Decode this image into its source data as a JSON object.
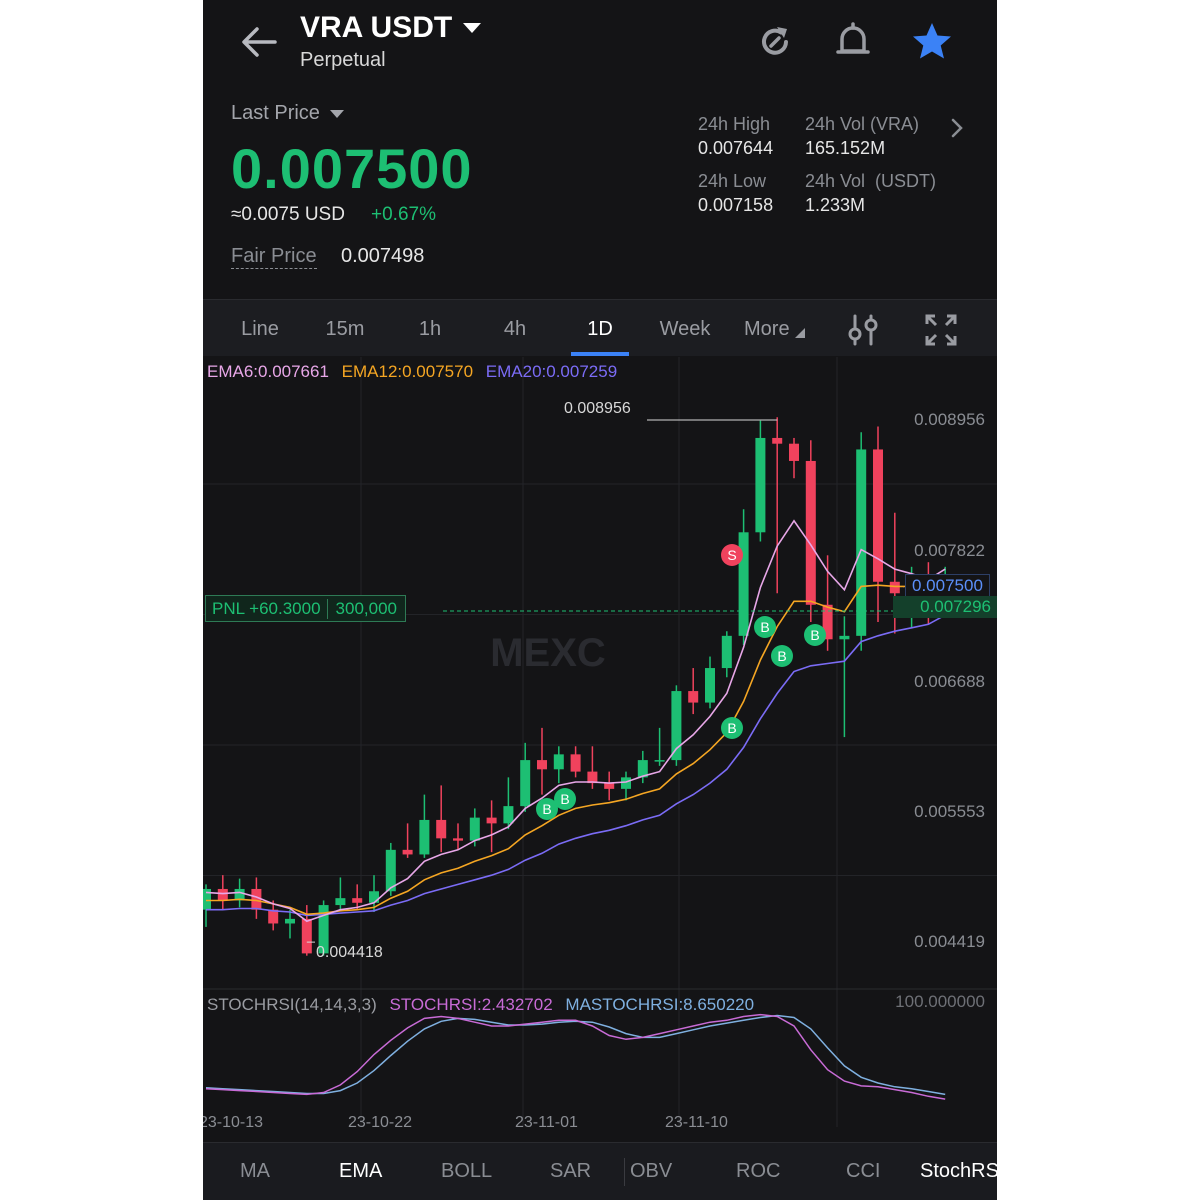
{
  "header": {
    "pair": "VRA USDT",
    "contract_type": "Perpetual",
    "icons": {
      "back": "back-arrow-icon",
      "dropdown": "caret-down-icon",
      "refresh": "refresh-icon",
      "alert": "bell-icon",
      "favorite": "star-icon"
    },
    "colors": {
      "favorite": "#3b82f6"
    }
  },
  "price": {
    "label": "Last Price",
    "value": "0.007500",
    "usd": "≈0.0075 USD",
    "change": "+0.67%",
    "fair_label": "Fair Price",
    "fair_value": "0.007498"
  },
  "stats": {
    "high_label": "24h High",
    "high": "0.007644",
    "low_label": "24h Low",
    "low": "0.007158",
    "vol_vra_label": "24h Vol (VRA)",
    "vol_vra": "165.152M",
    "vol_usdt_label": "24h Vol  (USDT)",
    "vol_usdt": "1.233M"
  },
  "timeframes": [
    "Line",
    "15m",
    "1h",
    "4h",
    "1D",
    "Week",
    "More"
  ],
  "active_timeframe": "1D",
  "ema_legend": {
    "ema6": "EMA6:0.007661",
    "ema12": "EMA12:0.007570",
    "ema20": "EMA20:0.007259"
  },
  "chart_labels": {
    "max": "0.008956",
    "min": "0.004418",
    "current": "0.007500",
    "pnl_price": "0.007296",
    "pnl_label": "PNL +60.3000",
    "pnl_size": "300,000",
    "watermark": "MEXC"
  },
  "y_axis": [
    "0.008956",
    "0.007822",
    "0.006688",
    "0.005553",
    "0.004419"
  ],
  "stoch_legend": {
    "params": "STOCHRSI(14,14,3,3)",
    "stoch": "STOCHRSI:2.432702",
    "ma": "MASTOCHRSI:8.650220",
    "top": "100.000000"
  },
  "x_axis": [
    "23-10-13",
    "23-10-22",
    "23-11-01",
    "23-11-10"
  ],
  "indicator_tabs": [
    "MA",
    "EMA",
    "BOLL",
    "SAR",
    "OBV",
    "ROC",
    "CCI",
    "StochRSI"
  ],
  "active_indicator": "EMA",
  "colors": {
    "up": "#1dbf73",
    "down": "#f0425d",
    "ema6": "#e8a7e8",
    "ema12": "#f5a623",
    "ema20": "#7b6cf6",
    "stochrsi": "#c86bd6",
    "mastochrsi": "#7fb0e0"
  },
  "chart_data": {
    "type": "candlestick",
    "interval": "1D",
    "candles": [
      {
        "o": 0.0047,
        "h": 0.00492,
        "l": 0.00455,
        "c": 0.00488
      },
      {
        "o": 0.00488,
        "h": 0.005,
        "l": 0.0047,
        "c": 0.00478
      },
      {
        "o": 0.00478,
        "h": 0.00497,
        "l": 0.00472,
        "c": 0.00488
      },
      {
        "o": 0.00488,
        "h": 0.00498,
        "l": 0.00462,
        "c": 0.0047
      },
      {
        "o": 0.0047,
        "h": 0.00478,
        "l": 0.00452,
        "c": 0.00458
      },
      {
        "o": 0.00458,
        "h": 0.0047,
        "l": 0.00445,
        "c": 0.00462
      },
      {
        "o": 0.00462,
        "h": 0.00474,
        "l": 0.0043,
        "c": 0.00432
      },
      {
        "o": 0.00432,
        "h": 0.00478,
        "l": 0.0043,
        "c": 0.00474
      },
      {
        "o": 0.00474,
        "h": 0.00498,
        "l": 0.0047,
        "c": 0.0048
      },
      {
        "o": 0.0048,
        "h": 0.00492,
        "l": 0.0047,
        "c": 0.00476
      },
      {
        "o": 0.00476,
        "h": 0.005,
        "l": 0.00468,
        "c": 0.00486
      },
      {
        "o": 0.00486,
        "h": 0.00528,
        "l": 0.00482,
        "c": 0.00522
      },
      {
        "o": 0.00522,
        "h": 0.00545,
        "l": 0.00515,
        "c": 0.00518
      },
      {
        "o": 0.00518,
        "h": 0.0057,
        "l": 0.00515,
        "c": 0.00548
      },
      {
        "o": 0.00548,
        "h": 0.00578,
        "l": 0.0052,
        "c": 0.00532
      },
      {
        "o": 0.00532,
        "h": 0.00545,
        "l": 0.00522,
        "c": 0.0053
      },
      {
        "o": 0.0053,
        "h": 0.00558,
        "l": 0.00525,
        "c": 0.0055
      },
      {
        "o": 0.0055,
        "h": 0.00565,
        "l": 0.0052,
        "c": 0.00545
      },
      {
        "o": 0.00545,
        "h": 0.00585,
        "l": 0.0054,
        "c": 0.0056
      },
      {
        "o": 0.0056,
        "h": 0.00615,
        "l": 0.00555,
        "c": 0.006
      },
      {
        "o": 0.006,
        "h": 0.00628,
        "l": 0.0057,
        "c": 0.00592
      },
      {
        "o": 0.00592,
        "h": 0.00612,
        "l": 0.0058,
        "c": 0.00605
      },
      {
        "o": 0.00605,
        "h": 0.00612,
        "l": 0.00585,
        "c": 0.0059
      },
      {
        "o": 0.0059,
        "h": 0.00612,
        "l": 0.00575,
        "c": 0.0058
      },
      {
        "o": 0.0058,
        "h": 0.0059,
        "l": 0.00565,
        "c": 0.00575
      },
      {
        "o": 0.00575,
        "h": 0.0059,
        "l": 0.00565,
        "c": 0.00585
      },
      {
        "o": 0.00585,
        "h": 0.00608,
        "l": 0.0058,
        "c": 0.006
      },
      {
        "o": 0.006,
        "h": 0.00628,
        "l": 0.00595,
        "c": 0.006
      },
      {
        "o": 0.006,
        "h": 0.00665,
        "l": 0.00595,
        "c": 0.0066
      },
      {
        "o": 0.0066,
        "h": 0.0068,
        "l": 0.0064,
        "c": 0.0065
      },
      {
        "o": 0.0065,
        "h": 0.0069,
        "l": 0.00645,
        "c": 0.0068
      },
      {
        "o": 0.0068,
        "h": 0.00712,
        "l": 0.00672,
        "c": 0.00708
      },
      {
        "o": 0.00708,
        "h": 0.00818,
        "l": 0.007,
        "c": 0.00798
      },
      {
        "o": 0.00798,
        "h": 0.00895,
        "l": 0.0079,
        "c": 0.0088
      },
      {
        "o": 0.0088,
        "h": 0.00898,
        "l": 0.00745,
        "c": 0.00875
      },
      {
        "o": 0.00875,
        "h": 0.0088,
        "l": 0.00845,
        "c": 0.0086
      },
      {
        "o": 0.0086,
        "h": 0.00878,
        "l": 0.0072,
        "c": 0.00735
      },
      {
        "o": 0.00735,
        "h": 0.00778,
        "l": 0.00695,
        "c": 0.00705
      },
      {
        "o": 0.00705,
        "h": 0.00725,
        "l": 0.0062,
        "c": 0.00708
      },
      {
        "o": 0.00708,
        "h": 0.00885,
        "l": 0.00695,
        "c": 0.0087
      },
      {
        "o": 0.0087,
        "h": 0.0089,
        "l": 0.0072,
        "c": 0.00755
      },
      {
        "o": 0.00755,
        "h": 0.00815,
        "l": 0.0071,
        "c": 0.00745
      },
      {
        "o": 0.00745,
        "h": 0.00768,
        "l": 0.00715,
        "c": 0.00752
      },
      {
        "o": 0.00752,
        "h": 0.00772,
        "l": 0.00718,
        "c": 0.00745
      },
      {
        "o": 0.00745,
        "h": 0.00768,
        "l": 0.0073,
        "c": 0.0075
      }
    ],
    "ema6": [
      0.00485,
      0.00484,
      0.00485,
      0.00481,
      0.00475,
      0.00471,
      0.0046,
      0.00465,
      0.0047,
      0.00472,
      0.00476,
      0.00489,
      0.00497,
      0.00512,
      0.00518,
      0.00522,
      0.0053,
      0.00535,
      0.00542,
      0.00558,
      0.00567,
      0.00578,
      0.00581,
      0.00581,
      0.0058,
      0.00581,
      0.00586,
      0.0059,
      0.0061,
      0.00622,
      0.00638,
      0.00658,
      0.00698,
      0.0075,
      0.00786,
      0.00808,
      0.00787,
      0.00764,
      0.00748,
      0.00783,
      0.00775,
      0.00766,
      0.00762,
      0.00757,
      0.00766
    ],
    "ema12": [
      0.00478,
      0.00478,
      0.00479,
      0.00478,
      0.00475,
      0.00472,
      0.00466,
      0.00467,
      0.00469,
      0.0047,
      0.00472,
      0.0048,
      0.00486,
      0.00496,
      0.00502,
      0.00506,
      0.00512,
      0.00517,
      0.00523,
      0.00535,
      0.00543,
      0.00552,
      0.00558,
      0.00561,
      0.00563,
      0.00566,
      0.00571,
      0.00575,
      0.00588,
      0.00597,
      0.00609,
      0.00624,
      0.00651,
      0.00687,
      0.00716,
      0.00738,
      0.00738,
      0.00733,
      0.00729,
      0.00751,
      0.00752,
      0.00751,
      0.00751,
      0.0075,
      0.00757
    ],
    "ema20": [
      0.0047,
      0.0047,
      0.00471,
      0.00471,
      0.00469,
      0.00468,
      0.00465,
      0.00466,
      0.00467,
      0.00468,
      0.00469,
      0.00474,
      0.00478,
      0.00484,
      0.00488,
      0.00492,
      0.00496,
      0.005,
      0.00505,
      0.00513,
      0.00519,
      0.00527,
      0.00532,
      0.00536,
      0.00539,
      0.00543,
      0.00548,
      0.00552,
      0.00562,
      0.0057,
      0.0058,
      0.00592,
      0.00611,
      0.00636,
      0.00658,
      0.00677,
      0.00682,
      0.00684,
      0.00686,
      0.00703,
      0.00708,
      0.00712,
      0.00715,
      0.00718,
      0.00726
    ],
    "stochrsi": [
      14,
      13,
      12,
      11,
      10,
      9,
      8,
      10,
      18,
      32,
      50,
      65,
      78,
      88,
      90,
      88,
      84,
      80,
      80,
      82,
      84,
      86,
      86,
      80,
      70,
      66,
      68,
      72,
      76,
      80,
      84,
      86,
      90,
      92,
      90,
      80,
      55,
      34,
      22,
      17,
      16,
      13,
      10,
      6,
      3
    ],
    "mastochrsi": [
      15,
      14,
      13,
      12,
      11,
      10,
      9,
      9,
      12,
      20,
      33,
      49,
      64,
      77,
      85,
      88,
      87,
      84,
      81,
      81,
      82,
      84,
      85,
      84,
      79,
      72,
      68,
      68,
      72,
      76,
      80,
      83,
      86,
      89,
      91,
      89,
      77,
      57,
      38,
      26,
      20,
      16,
      14,
      11,
      8
    ],
    "y_axis_ticks": [
      0.008956,
      0.007822,
      0.006688,
      0.005553,
      0.004419
    ],
    "high": 0.008956,
    "low": 0.004418,
    "last": 0.0075,
    "position_entry": 0.007296,
    "trade_markers": [
      {
        "index": 20,
        "side": "B"
      },
      {
        "index": 21,
        "side": "B"
      },
      {
        "index": 38,
        "side": "S"
      },
      {
        "index": 38,
        "side": "B"
      },
      {
        "index": 40,
        "side": "B"
      },
      {
        "index": 41,
        "side": "B"
      },
      {
        "index": 43,
        "side": "B"
      }
    ]
  }
}
